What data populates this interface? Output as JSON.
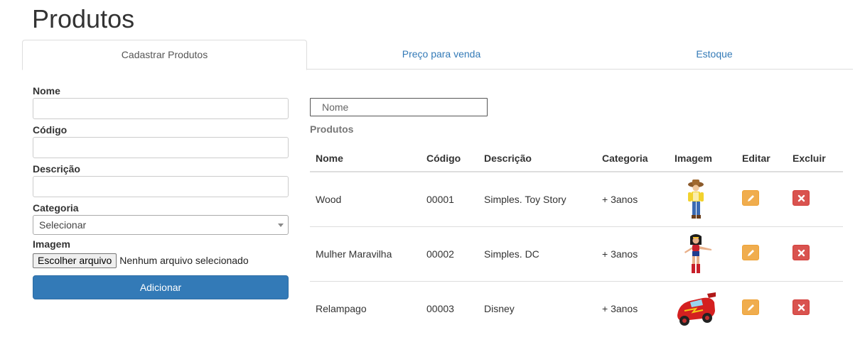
{
  "page": {
    "title": "Produtos"
  },
  "tabs": [
    {
      "label": "Cadastrar Produtos",
      "active": true
    },
    {
      "label": "Preço para venda",
      "active": false
    },
    {
      "label": "Estoque",
      "active": false
    }
  ],
  "form": {
    "nome_label": "Nome",
    "nome_value": "",
    "codigo_label": "Código",
    "codigo_value": "",
    "descricao_label": "Descrição",
    "descricao_value": "",
    "categoria_label": "Categoria",
    "categoria_selected": "Selecionar",
    "imagem_label": "Imagem",
    "file_button": "Escolher arquivo",
    "file_status": "Nenhum arquivo selecionado",
    "submit_label": "Adicionar"
  },
  "search": {
    "placeholder": "Nome"
  },
  "list": {
    "heading": "Produtos",
    "columns": [
      "Nome",
      "Código",
      "Descrição",
      "Categoria",
      "Imagem",
      "Editar",
      "Excluir"
    ],
    "rows": [
      {
        "nome": "Wood",
        "codigo": "00001",
        "descricao": "Simples. Toy Story",
        "categoria": "+ 3anos",
        "imagem": "woody-toy-image"
      },
      {
        "nome": "Mulher Maravilha",
        "codigo": "00002",
        "descricao": "Simples. DC",
        "categoria": "+ 3anos",
        "imagem": "wonder-woman-toy-image"
      },
      {
        "nome": "Relampago",
        "codigo": "00003",
        "descricao": "Disney",
        "categoria": "+ 3anos",
        "imagem": "lightning-car-toy-image"
      }
    ]
  },
  "icons": {
    "edit": "pencil-icon",
    "delete": "close-icon"
  },
  "colors": {
    "primary": "#337ab7",
    "warning": "#f0ad4e",
    "danger": "#d9534f",
    "link": "#337ab7"
  }
}
